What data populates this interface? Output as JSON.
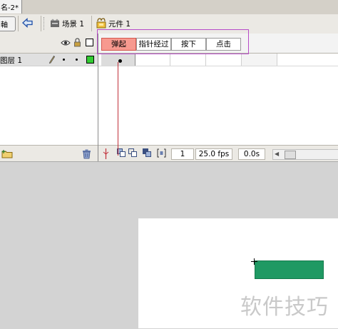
{
  "document_tab": {
    "title": "名-2*",
    "close_glyph": "×"
  },
  "edit_bar": {
    "timeline_button_label": "軸",
    "scene_label": "场景 1",
    "symbol_label": "元件 1"
  },
  "layer_panel": {
    "layer_name": "图层 1",
    "layer_color": "#33cc33"
  },
  "frame_labels": {
    "up": "弹起",
    "over": "指针经过",
    "down": "按下",
    "hit": "点击"
  },
  "status_bar": {
    "current_frame": "1",
    "frame_rate": "25.0 fps",
    "elapsed_time": "0.0s"
  },
  "stage": {
    "button_color": "#1f9963"
  },
  "watermark": {
    "text": "软件技巧"
  },
  "colors": {
    "highlight_border": "#b74bc8",
    "active_frame_tab": "#f7998f",
    "playhead": "#c0303a"
  }
}
